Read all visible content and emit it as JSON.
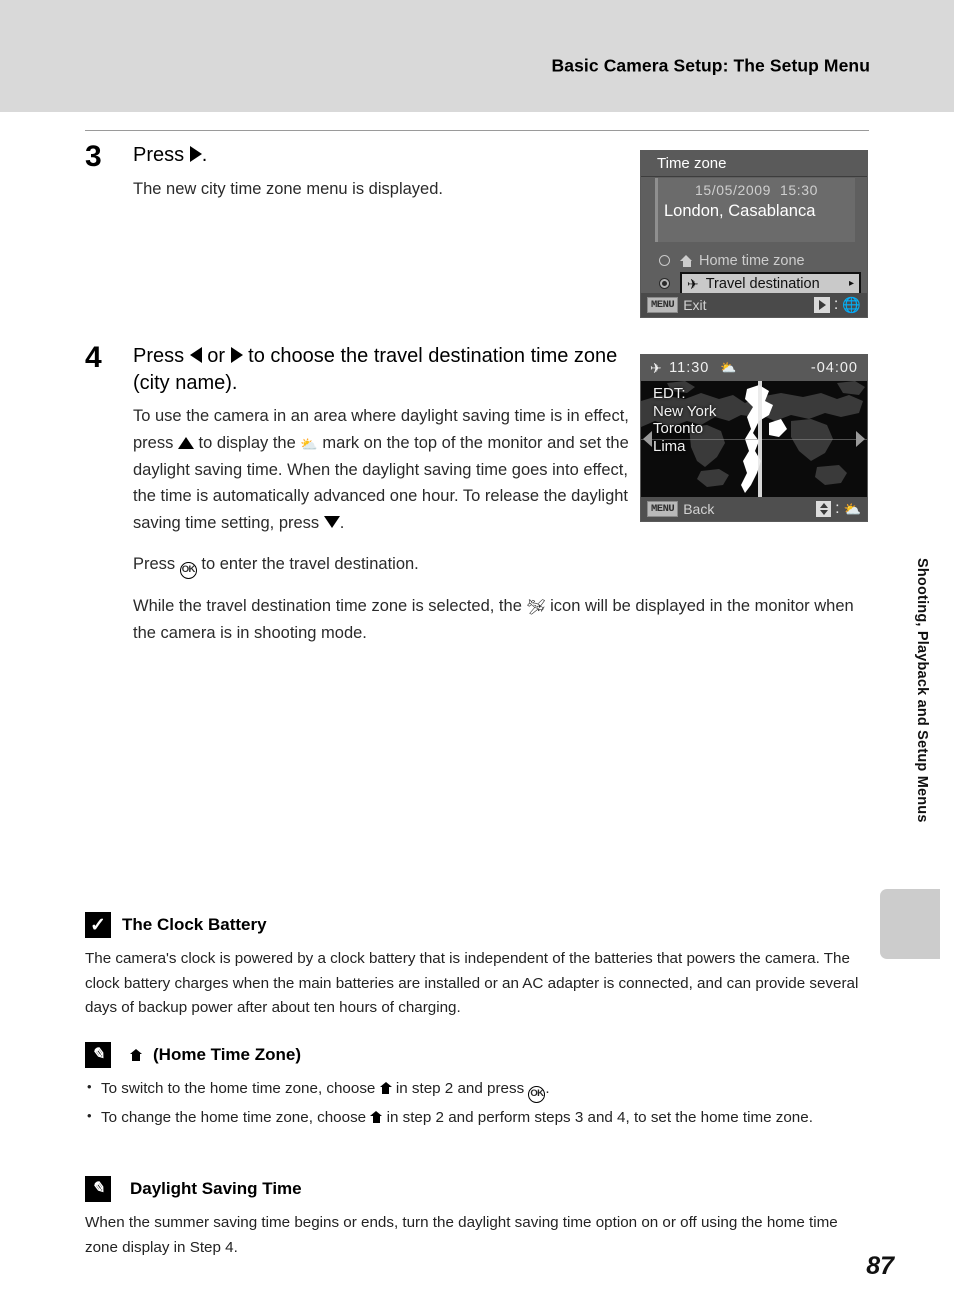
{
  "header": {
    "title": "Basic Camera Setup: The Setup Menu"
  },
  "side_tab": {
    "label": "Shooting, Playback and Setup Menus"
  },
  "page_number": "87",
  "steps": [
    {
      "number": "3",
      "heading_before": "Press",
      "heading_icon": "right-arrow-button",
      "heading_after": ".",
      "paragraphs": [
        "The new city time zone menu is displayed."
      ]
    },
    {
      "number": "4",
      "heading_line1_a": "Press",
      "heading_icon_left": "left-arrow-button",
      "heading_line1_b": "or",
      "heading_icon_right": "right-arrow-button",
      "heading_line1_c": "to choose the travel destination",
      "heading_line2": "time zone (city name).",
      "p1_a": "To use the camera in an area where daylight saving time is in effect, press",
      "p1_icon_up": "up-arrow-button",
      "p1_b": "to display the",
      "p1_icon_dst": "daylight-saving-icon",
      "p1_c": "mark on the top of the monitor and set the daylight saving time. When the daylight saving time goes into effect, the time is automatically advanced one hour. To release the daylight saving time setting, press",
      "p1_icon_down": "down-arrow-button",
      "p1_d": ".",
      "p2_a": "Press",
      "p2_icon_ok": "OK",
      "p2_b": "to enter the travel destination.",
      "p3_a": "While the travel destination time zone is selected, the",
      "p3_icon_travel": "travel-destination-icon",
      "p3_b": "icon will be displayed in the monitor when the camera is in shooting mode."
    }
  ],
  "screen_timezone": {
    "title": "Time zone",
    "date": "15/05/2009",
    "time": "15:30",
    "city": "London, Casablanca",
    "option_home": "Home time zone",
    "option_travel": "Travel destination",
    "selected_option": "Travel destination",
    "bottom_menu_chip": "MENU",
    "bottom_label": "Exit",
    "bottom_right_separator": ":",
    "icons": {
      "home": "home-icon",
      "plane": "✈",
      "globe": "⊕",
      "arrow_right_small": "▸"
    }
  },
  "screen_map": {
    "plane_icon": "✈",
    "time": "11:30",
    "dst_icon": "daylight-saving-icon",
    "utc_offset": "-04:00",
    "zone_abbr": "EDT:",
    "cities": [
      "New York",
      "Toronto",
      "Lima"
    ],
    "bottom_menu_chip": "MENU",
    "bottom_label": "Back",
    "bottom_right_separator": ":"
  },
  "notes": [
    {
      "badge": "check-badge-icon",
      "title": "The Clock Battery",
      "body": "The camera's clock is powered by a clock battery that is independent of the batteries that powers the camera. The clock battery charges when the main batteries are installed or an AC adapter is connected, and can provide several days of backup power after about ten hours of charging."
    },
    {
      "badge": "pencil-badge-icon",
      "title_icon": "home-icon",
      "title": "(Home Time Zone)",
      "bullets": [
        {
          "a": "To switch to the home time zone, choose",
          "icon1": "home-icon",
          "b": "in step 2 and press",
          "icon2": "OK",
          "c": "."
        },
        {
          "a": "To change the home time zone, choose",
          "icon1": "home-icon",
          "b": "in step 2 and perform steps 3 and 4, to set the home time zone.",
          "icon2": "",
          "c": ""
        }
      ]
    },
    {
      "badge": "pencil-badge-icon",
      "title": "Daylight Saving Time",
      "body": "When the summer saving time begins or ends, turn the daylight saving time option on or off using the home time zone display in Step 4."
    }
  ]
}
